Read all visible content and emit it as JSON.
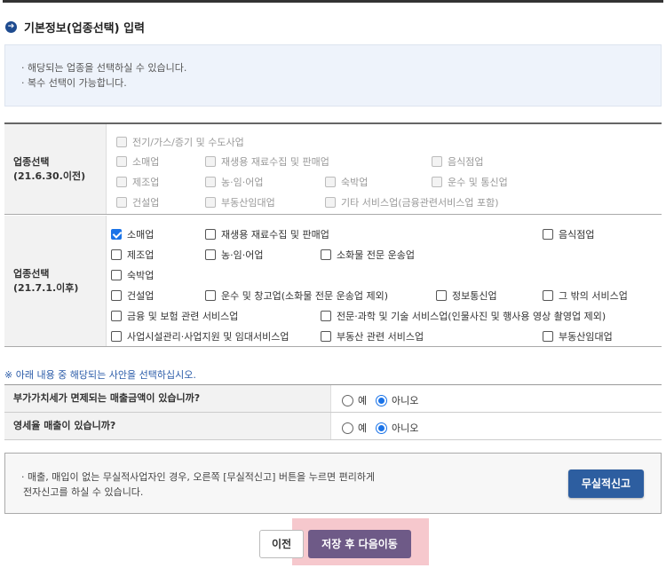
{
  "section_title": "기본정보(업종선택) 입력",
  "info": [
    "해당되는 업종을 선택하실 수 있습니다.",
    "복수 선택이 가능합니다."
  ],
  "old_section": {
    "label1": "업종선택",
    "label2": "(21.6.30.이전)",
    "items": [
      "전기/가스/증기 및 수도사업",
      "소매업",
      "재생용 재료수집 및 판매업",
      "음식점업",
      "제조업",
      "농·임·어업",
      "숙박업",
      "운수 및 통신업",
      "건설업",
      "부동산임대업",
      "기타 서비스업(금융관련서비스업 포함)"
    ]
  },
  "new_section": {
    "label1": "업종선택",
    "label2": "(21.7.1.이후)",
    "items": [
      "소매업",
      "재생용 재료수집 및 판매업",
      "음식점업",
      "제조업",
      "농·임·어업",
      "소화물 전문 운송업",
      "숙박업",
      "건설업",
      "운수 및 창고업(소화물 전문 운송업 제외)",
      "정보통신업",
      "그 밖의 서비스업",
      "금융 및 보험 관련 서비스업",
      "전문·과학 및 기술 서비스업(인물사진 및 행사용 영상 촬영업 제외)",
      "사업시설관리·사업지원 및 임대서비스업",
      "부동산 관련 서비스업",
      "부동산임대업"
    ],
    "checked": [
      "소매업"
    ]
  },
  "note": "※ 아래 내용 중 해당되는 사안을 선택하십시오.",
  "questions": [
    {
      "label": "부가가치세가 면제되는 매출금액이 있습니까?",
      "yes": "예",
      "no": "아니오",
      "selected": "아니오"
    },
    {
      "label": "영세율 매출이 있습니까?",
      "yes": "예",
      "no": "아니오",
      "selected": "아니오"
    }
  ],
  "notice": {
    "line1": "매출, 매입이 없는 무실적사업자인 경우, 오른쪽 [무실적신고] 버튼을 누르면 편리하게",
    "line2": "전자신고를 하실 수 있습니다.",
    "button": "무실적신고"
  },
  "buttons": {
    "prev": "이전",
    "next": "저장 후 다음이동"
  },
  "colors": {
    "primary": "#2d5ea0",
    "next_button": "#6e5a87",
    "highlight": "#f6c8cd",
    "check": "#1a73e8"
  }
}
